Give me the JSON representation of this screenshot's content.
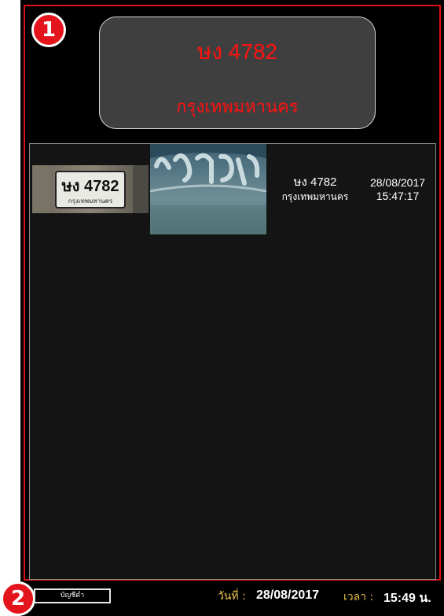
{
  "markers": {
    "one": "1",
    "two": "2"
  },
  "current_plate": {
    "number": "ษง 4782",
    "province": "กรุงเทพมหานคร"
  },
  "detections": [
    {
      "plate_image_text": "ษง 4782",
      "plate_image_subtext": "กรุงเทพมหานคร",
      "plate": "ษง 4782",
      "province": "กรุงเทพมหานคร",
      "date": "28/08/2017",
      "time": "15:47:17"
    }
  ],
  "status_bar": {
    "history_button": "บัญชีดำ",
    "date_label": "วันที่ :",
    "date_value": "28/08/2017",
    "time_label": "เวลา :",
    "time_value": "15:49 น."
  },
  "colors": {
    "plate_text": "#ff1111",
    "frame": "#e01010",
    "badge": "#e3141b",
    "label": "#e7c24a",
    "background": "#000000"
  }
}
